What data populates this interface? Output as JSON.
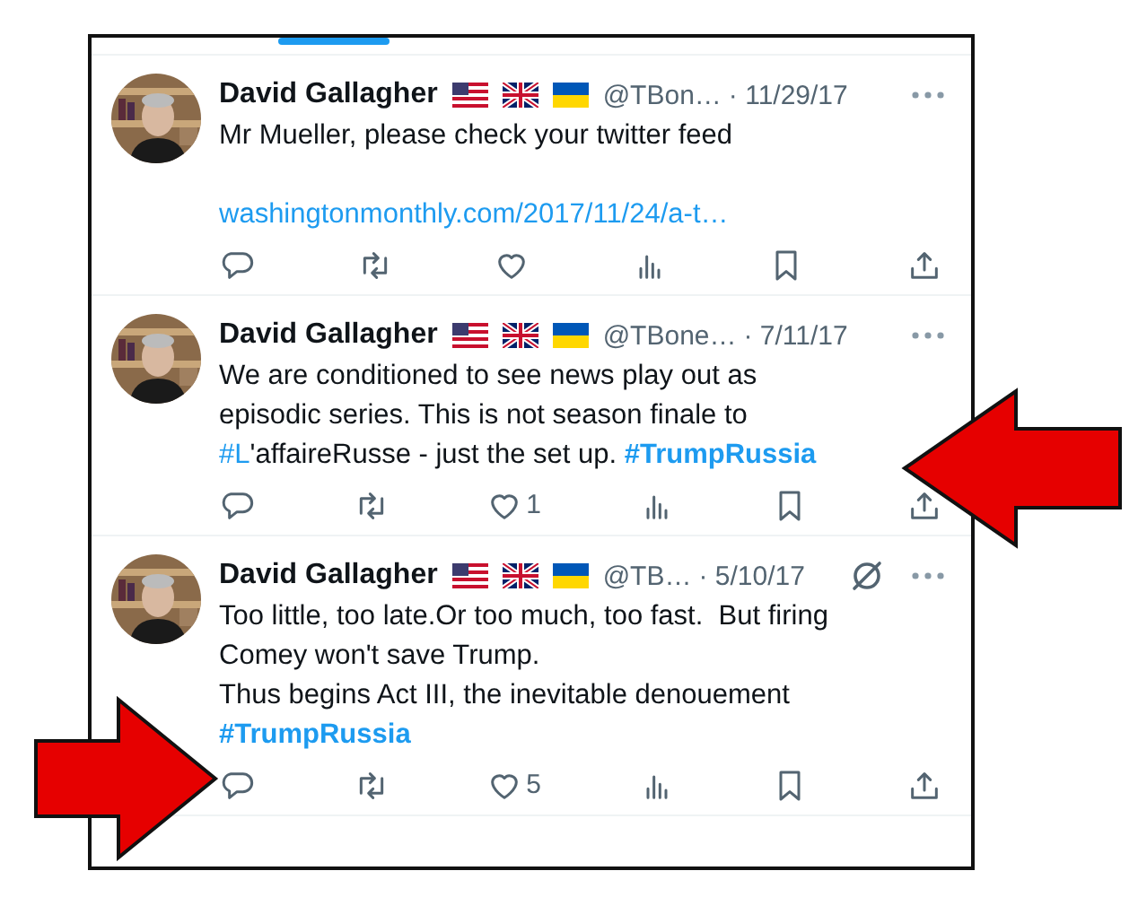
{
  "tweets": [
    {
      "name": "David Gallagher",
      "handle": "@TBon…",
      "date": "· 11/29/17",
      "extra_icon": false,
      "body": [
        {
          "kind": "text",
          "text": "Mr Mueller, please check your twitter feed\n\n"
        },
        {
          "kind": "link",
          "text": "washingtonmonthly.com/2017/11/24/a-t…"
        }
      ]
    },
    {
      "name": "David Gallagher",
      "handle": "@TBone…",
      "date": "· 7/11/17",
      "extra_icon": false,
      "body": [
        {
          "kind": "text",
          "text": "We are conditioned to see news play out as\nepisodic series. This is not season finale to\n"
        },
        {
          "kind": "tag",
          "text": "#L"
        },
        {
          "kind": "text",
          "text": "'affaireRusse - just the set up. "
        },
        {
          "kind": "tag_bold",
          "text": "#TrumpRussia"
        }
      ],
      "likes": "1"
    },
    {
      "name": "David Gallagher",
      "handle": "@TB…",
      "date": "· 5/10/17",
      "extra_icon": true,
      "body": [
        {
          "kind": "text",
          "text": "Too little, too late.Or too much, too fast.  But firing\nComey won't save Trump.\nThus begins Act III, the inevitable denouement\n"
        },
        {
          "kind": "tag_bold",
          "text": "#TrumpRussia"
        }
      ],
      "likes": "5"
    }
  ]
}
